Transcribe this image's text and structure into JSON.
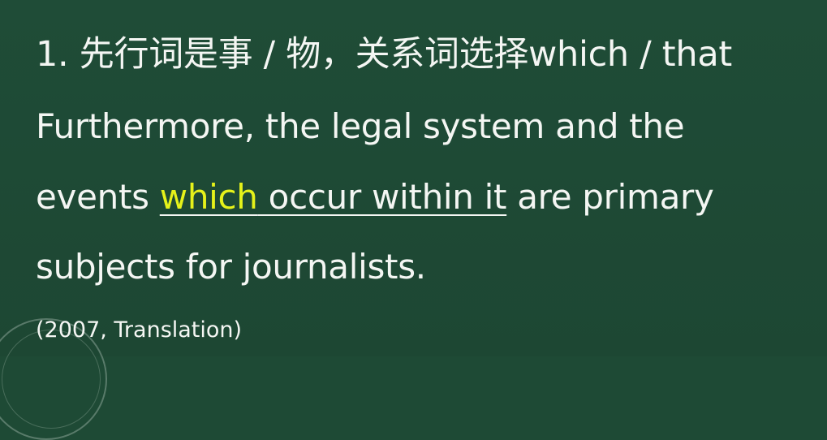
{
  "slide": {
    "line1": "1. 先行词是事 / 物，关系词选择which / that",
    "line2": "Furthermore, the legal system and the",
    "line3_pre": "events ",
    "line3_which": "which",
    "line3_clause": " occur within it",
    "line3_post": " are primary",
    "line4": "subjects for journalists.",
    "citation": "(2007, Translation)"
  },
  "colors": {
    "background": "#1e4a35",
    "text": "#f4f6f3",
    "highlight": "#e6f21a"
  }
}
